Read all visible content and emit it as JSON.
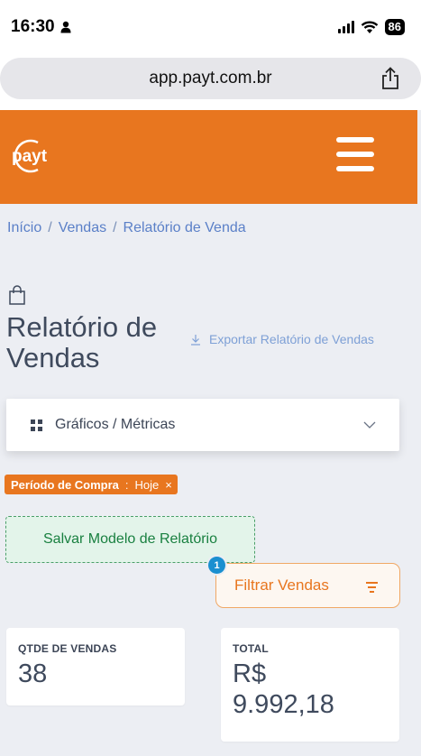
{
  "status_bar": {
    "time": "16:30",
    "battery": "86"
  },
  "browser": {
    "url": "app.payt.com.br"
  },
  "header": {
    "logo_text": "payt"
  },
  "breadcrumb": {
    "items": [
      "Início",
      "Vendas",
      "Relatório de Venda"
    ],
    "separator": "/"
  },
  "page": {
    "title": "Relatório de Vendas",
    "export_label": "Exportar Relatório de Vendas"
  },
  "metrics_panel": {
    "label": "Gráficos / Métricas"
  },
  "active_filter": {
    "name": "Período de Compra",
    "separator": ":",
    "value": "Hoje"
  },
  "save_template": {
    "label": "Salvar Modelo de Relatório"
  },
  "filter_button": {
    "label": "Filtrar Vendas",
    "badge_count": "1"
  },
  "cards": {
    "qtde": {
      "label": "QTDE DE VENDAS",
      "value": "38"
    },
    "total": {
      "label": "TOTAL",
      "value_line1": "R$",
      "value_line2": "9.992,18"
    }
  },
  "colors": {
    "brand": "#e8761f",
    "link": "#5b80c8",
    "success": "#198040",
    "badge": "#1a8fd0"
  }
}
